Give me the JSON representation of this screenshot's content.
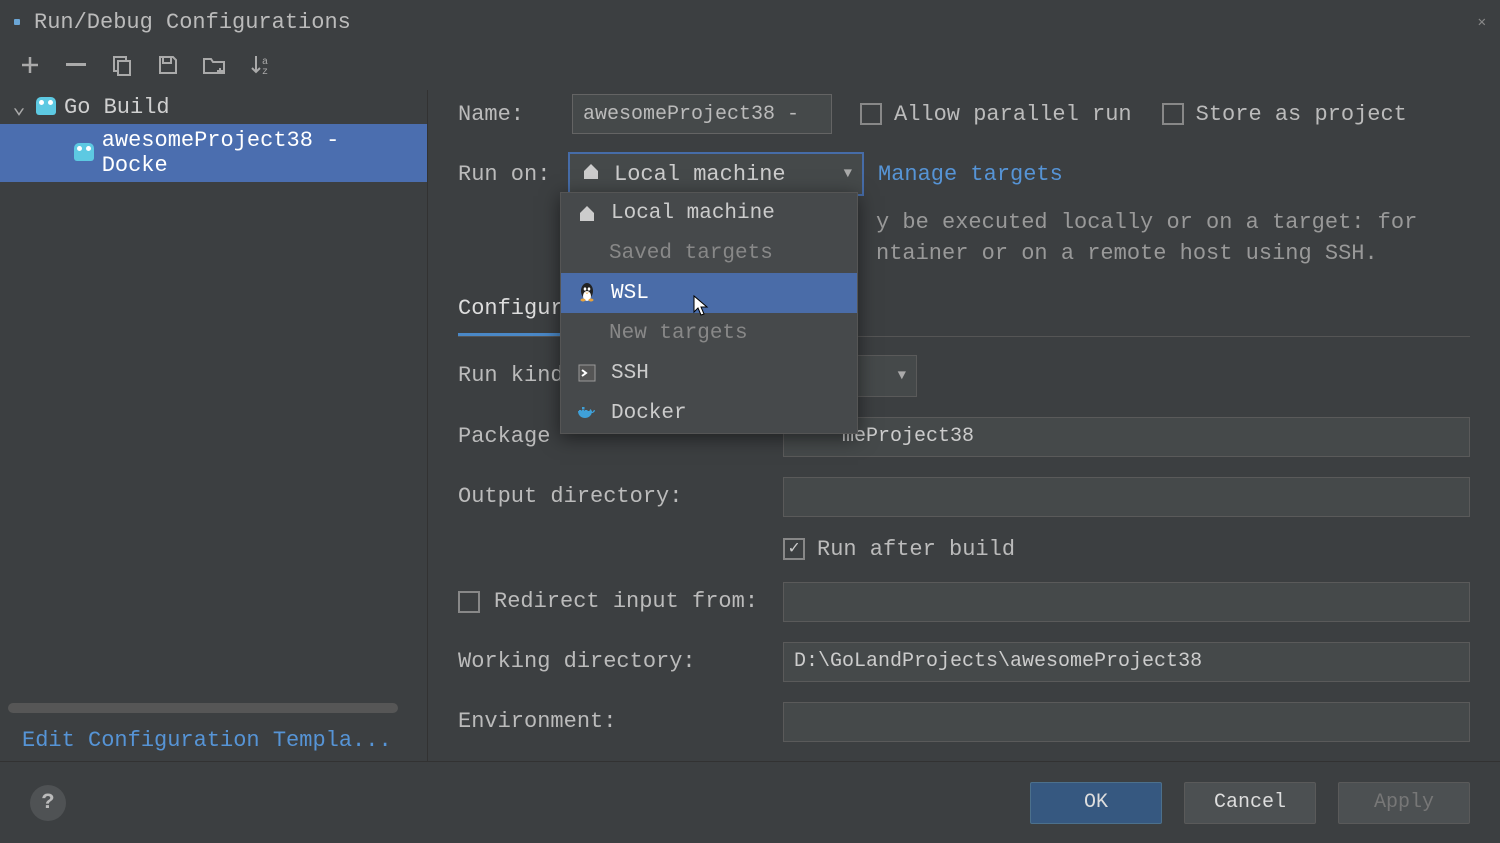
{
  "title": "Run/Debug Configurations",
  "sidebar": {
    "group": "Go Build",
    "item": "awesomeProject38 - Docke",
    "edit_templates": "Edit Configuration Templa..."
  },
  "header": {
    "name_label": "Name:",
    "name_value": "awesomeProject38 -",
    "allow_parallel": "Allow parallel run",
    "store_project": "Store as project"
  },
  "runon": {
    "label": "Run on:",
    "selected": "Local machine",
    "manage": "Manage targets",
    "hint1": "y be executed locally or on a target: for",
    "hint2": "ntainer or on a remote host using SSH."
  },
  "dropdown": {
    "local": "Local machine",
    "saved_hdr": "Saved targets",
    "wsl": "WSL",
    "new_hdr": "New targets",
    "ssh": "SSH",
    "docker": "Docker"
  },
  "tabs": {
    "config": "Configur"
  },
  "form": {
    "run_kind": "Run kind",
    "package": "Package ",
    "package_val": "meProject38",
    "outdir": "Output directory:",
    "run_after": "Run after build",
    "redirect": "Redirect input from:",
    "workdir": "Working directory:",
    "workdir_val": "D:\\GoLandProjects\\awesomeProject38",
    "env": "Environment:"
  },
  "buttons": {
    "ok": "OK",
    "cancel": "Cancel",
    "apply": "Apply"
  }
}
